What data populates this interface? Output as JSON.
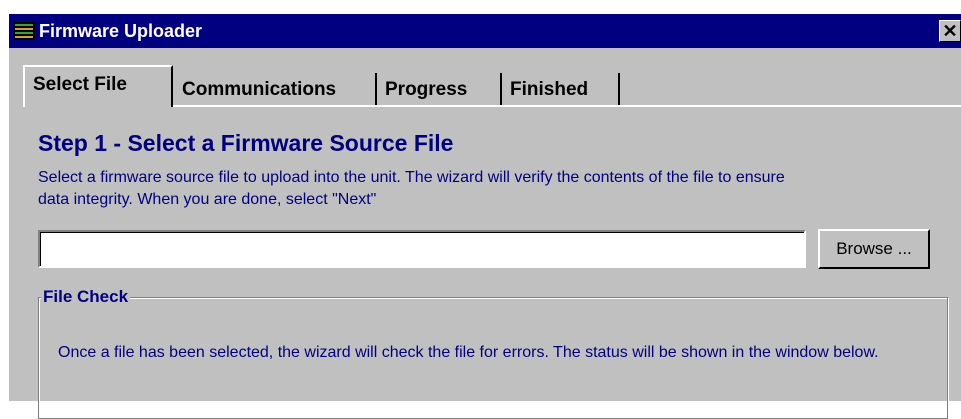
{
  "window": {
    "title": "Firmware Uploader",
    "close_label": "✕",
    "icon": "firmware-app-icon"
  },
  "tabs": [
    {
      "label": "Select File",
      "active": true
    },
    {
      "label": "Communications",
      "active": false
    },
    {
      "label": "Progress",
      "active": false
    },
    {
      "label": "Finished",
      "active": false
    }
  ],
  "step": {
    "title": "Step 1 - Select a Firmware Source File",
    "description": "Select a firmware source file to upload into the unit.  The wizard will verify the contents of the file to ensure data integrity.  When you are done, select \"Next\""
  },
  "file": {
    "value": "",
    "browse_label": "Browse ..."
  },
  "file_check": {
    "legend": "File Check",
    "text": "Once a file has been selected, the wizard will check the file for errors.  The status will be shown in the window below."
  },
  "colors": {
    "titlebar": "#000080",
    "face": "#c0c0c0",
    "label_text": "#000080"
  }
}
